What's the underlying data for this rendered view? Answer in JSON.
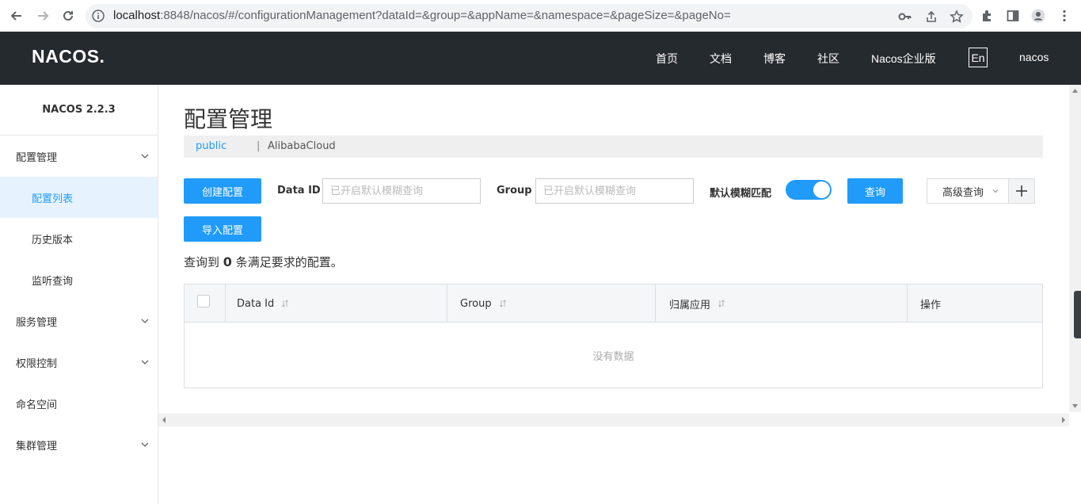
{
  "browser": {
    "url_host": "localhost",
    "url_rest": ":8848/nacos/#/configurationManagement?dataId=&group=&appName=&namespace=&pageSize=&pageNo="
  },
  "header": {
    "logo": "NACOS.",
    "nav": [
      "首页",
      "文档",
      "博客",
      "社区",
      "Nacos企业版"
    ],
    "lang": "En",
    "user": "nacos"
  },
  "sidebar": {
    "version": "NACOS 2.2.3",
    "items": [
      {
        "label": "配置管理",
        "expandable": true
      },
      {
        "label": "配置列表",
        "sub": true,
        "active": true
      },
      {
        "label": "历史版本",
        "sub": true
      },
      {
        "label": "监听查询",
        "sub": true
      },
      {
        "label": "服务管理",
        "expandable": true
      },
      {
        "label": "权限控制",
        "expandable": true
      },
      {
        "label": "命名空间"
      },
      {
        "label": "集群管理",
        "expandable": true
      }
    ]
  },
  "main": {
    "title": "配置管理",
    "namespaces": {
      "public": "public",
      "separator": "|",
      "alibaba": "AlibabaCloud"
    },
    "create_btn": "创建配置",
    "import_btn": "导入配置",
    "dataid_label": "Data ID",
    "dataid_placeholder": "已开启默认模糊查询",
    "group_label": "Group",
    "group_placeholder": "已开启默认模糊查询",
    "fuzzy_label": "默认模糊匹配",
    "fuzzy_on": true,
    "query_btn": "查询",
    "advanced_btn": "高级查询",
    "result_prefix": "查询到",
    "result_count": "0",
    "result_suffix": "条满足要求的配置。",
    "table": {
      "columns": [
        "Data Id",
        "Group",
        "归属应用",
        "操作"
      ],
      "empty": "没有数据"
    }
  },
  "colors": {
    "primary": "#209bfa",
    "header_bg": "#252a2f"
  }
}
